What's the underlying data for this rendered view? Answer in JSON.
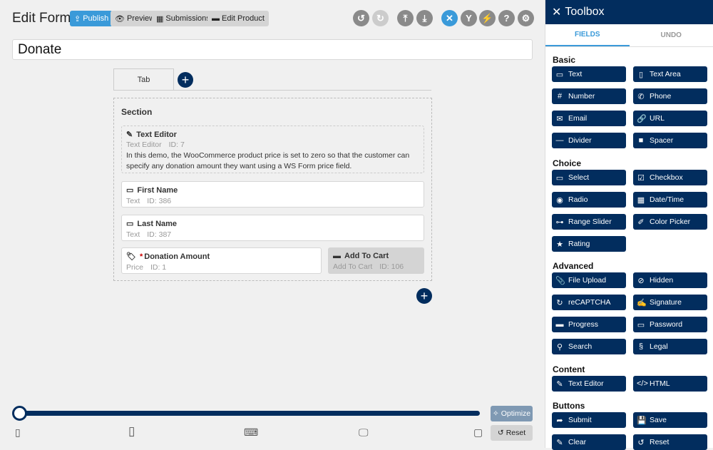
{
  "header": {
    "title": "Edit Form",
    "publish": "Publish",
    "preview": "Preview",
    "submissions": "Submissions",
    "edit_product": "Edit Product"
  },
  "toolbar_icons": [
    "undo-icon",
    "redo-icon",
    "upload-icon",
    "download-icon",
    "tools-icon",
    "conditional-icon",
    "actions-icon",
    "help-icon",
    "settings-icon"
  ],
  "form": {
    "name": "Donate",
    "tab": "Tab",
    "section": "Section",
    "fields": [
      {
        "name": "Text Editor",
        "type": "Text Editor",
        "id": "ID: 7",
        "desc": "In this demo, the WooCommerce product price is set to zero so that the customer can specify any donation amount they want using a WS Form price field."
      },
      {
        "name": "First Name",
        "type": "Text",
        "id": "ID: 386"
      },
      {
        "name": "Last Name",
        "type": "Text",
        "id": "ID: 387"
      },
      {
        "name": "Donation Amount",
        "required": "*",
        "type": "Price",
        "id": "ID: 1"
      },
      {
        "name": "Add To Cart",
        "type": "Add To Cart",
        "id": "ID: 106"
      }
    ]
  },
  "breakpoints": {
    "optimize": "Optimize",
    "reset": "Reset",
    "slider_value": 0
  },
  "toolbox": {
    "title": "Toolbox",
    "tabs": [
      "FIELDS",
      "UNDO"
    ],
    "groups": [
      {
        "label": "Basic",
        "items": [
          "Text",
          "Text Area",
          "Number",
          "Phone",
          "Email",
          "URL",
          "Divider",
          "Spacer"
        ]
      },
      {
        "label": "Choice",
        "items": [
          "Select",
          "Checkbox",
          "Radio",
          "Date/Time",
          "Range Slider",
          "Color Picker",
          "Rating"
        ]
      },
      {
        "label": "Advanced",
        "items": [
          "File Upload",
          "Hidden",
          "reCAPTCHA",
          "Signature",
          "Progress",
          "Password",
          "Search",
          "Legal"
        ]
      },
      {
        "label": "Content",
        "items": [
          "Text Editor",
          "HTML"
        ]
      },
      {
        "label": "Buttons",
        "items": [
          "Submit",
          "Save",
          "Clear",
          "Reset"
        ]
      }
    ]
  },
  "colors": {
    "navy": "#022d5e",
    "accent": "#3a9ad9"
  }
}
